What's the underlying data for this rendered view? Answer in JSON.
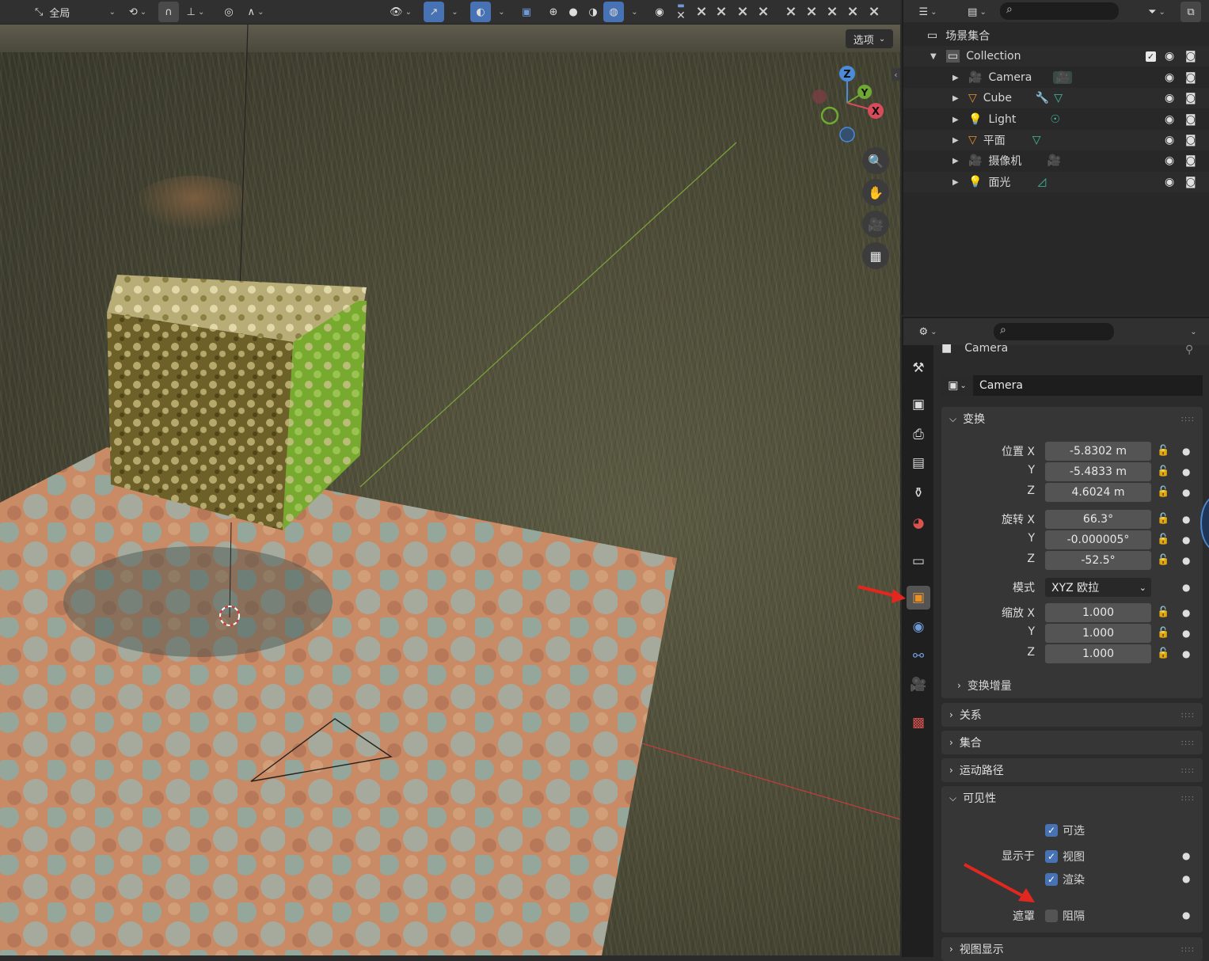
{
  "viewport": {
    "header": {
      "transform_orientation": "全局",
      "options_label": "选项"
    },
    "gizmo": {
      "x": "X",
      "y": "Y",
      "z": "Z"
    }
  },
  "outliner": {
    "scene_collection": "场景集合",
    "collection": "Collection",
    "items": [
      {
        "name": "Camera",
        "type": "camera"
      },
      {
        "name": "Cube",
        "type": "mesh"
      },
      {
        "name": "Light",
        "type": "light"
      },
      {
        "name": "平面",
        "type": "mesh"
      },
      {
        "name": "摄像机",
        "type": "camera"
      },
      {
        "name": "面光",
        "type": "light"
      }
    ]
  },
  "properties": {
    "context_name": "Camera",
    "object_name": "Camera",
    "transform": {
      "title": "变换",
      "location_label": "位置 X",
      "location": [
        "-5.8302 m",
        "-5.4833 m",
        "4.6024 m"
      ],
      "rotation_label": "旋转 X",
      "rotation": [
        "66.3°",
        "-0.000005°",
        "-52.5°"
      ],
      "mode_label": "模式",
      "mode_value": "XYZ 欧拉",
      "scale_label": "缩放 X",
      "scale": [
        "1.000",
        "1.000",
        "1.000"
      ],
      "axis_y": "Y",
      "axis_z": "Z",
      "delta": "变换增量"
    },
    "relations": "关系",
    "collections": "集合",
    "motion_paths": "运动路径",
    "visibility": {
      "title": "可见性",
      "selectable": "可选",
      "show_in": "显示于",
      "viewport": "视图",
      "render": "渲染",
      "mask": "遮罩",
      "holdout": "阻隔"
    },
    "viewport_display": "视图显示"
  },
  "colors": {
    "accent": "#4772b3",
    "active_tab": "#e8902a",
    "annotation_arrow": "#e2281e"
  }
}
